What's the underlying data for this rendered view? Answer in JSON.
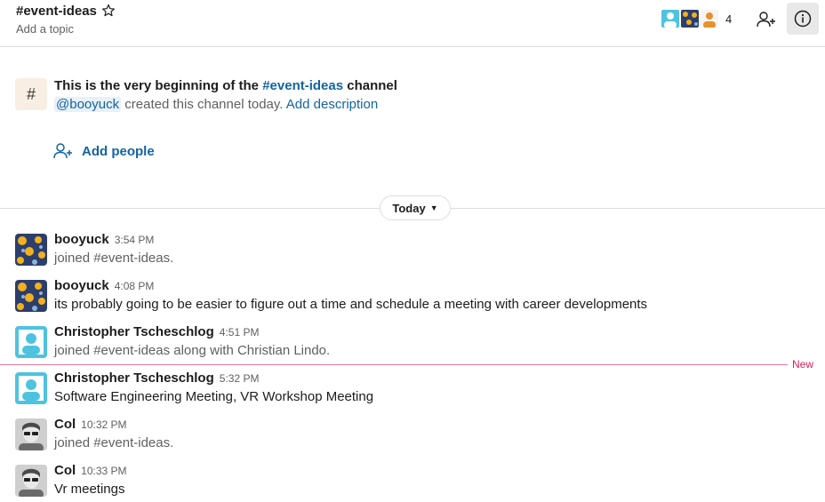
{
  "header": {
    "channel_name": "#event-ideas",
    "topic_placeholder": "Add a topic",
    "member_count": "4",
    "icons": [
      "star-icon",
      "add-member-icon",
      "info-icon"
    ]
  },
  "intro": {
    "title_prefix": "This is the very beginning of the ",
    "title_channel": "#event-ideas",
    "title_suffix": " channel",
    "creator": "@booyuck",
    "created_text": " created this channel today. ",
    "add_description": "Add description",
    "add_people": "Add people"
  },
  "divider": {
    "label": "Today"
  },
  "new_marker": "New",
  "messages": [
    {
      "sender": "booyuck",
      "time": "3:54 PM",
      "text": "joined #event-ideas.",
      "system": true,
      "avatar": "pattern"
    },
    {
      "sender": "booyuck",
      "time": "4:08 PM",
      "text": "its probably going to be easier to figure out a time and schedule a meeting with career developments",
      "system": false,
      "avatar": "pattern"
    },
    {
      "sender": "Christopher Tscheschlog",
      "time": "4:51 PM",
      "text": "joined #event-ideas along with Christian Lindo.",
      "system": true,
      "avatar": "default-teal"
    },
    {
      "sender": "Christopher Tscheschlog",
      "time": "5:32 PM",
      "text": "Software Engineering Meeting, VR Workshop Meeting",
      "system": false,
      "avatar": "default-teal"
    },
    {
      "sender": "Col",
      "time": "10:32 PM",
      "text": "joined #event-ideas.",
      "system": true,
      "avatar": "photo"
    },
    {
      "sender": "Col",
      "time": "10:33 PM",
      "text": "Vr meetings",
      "system": false,
      "avatar": "photo"
    }
  ],
  "colors": {
    "link": "#1264a3",
    "new_marker": "#e01e5a",
    "teal_avatar": "#4ec3e0",
    "pattern_bg": "#2c3e6b",
    "pattern_fg": "#f2b01e"
  }
}
